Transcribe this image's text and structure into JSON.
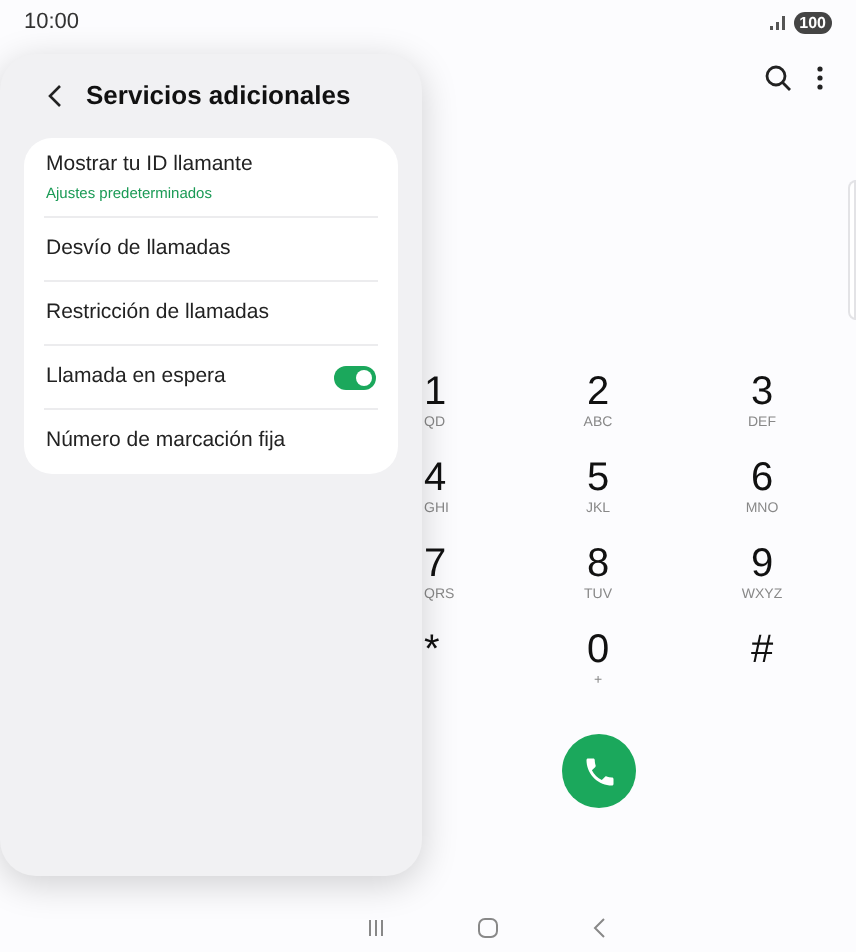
{
  "status_bar": {
    "time": "10:00",
    "battery": "100"
  },
  "panel": {
    "title": "Servicios adicionales",
    "items": [
      {
        "kind": "link",
        "label": "Mostrar tu ID llamante",
        "subtitle": "Ajustes predeterminados"
      },
      {
        "kind": "link",
        "label": "Desvío de llamadas"
      },
      {
        "kind": "link",
        "label": "Restricción de llamadas"
      },
      {
        "kind": "toggle",
        "label": "Llamada en espera",
        "on": true
      },
      {
        "kind": "link",
        "label": "Número de marcación fija"
      }
    ]
  },
  "keypad": [
    {
      "digit": "1",
      "letters": "QD"
    },
    {
      "digit": "2",
      "letters": "ABC"
    },
    {
      "digit": "3",
      "letters": "DEF"
    },
    {
      "digit": "4",
      "letters": "GHI"
    },
    {
      "digit": "5",
      "letters": "JKL"
    },
    {
      "digit": "6",
      "letters": "MNO"
    },
    {
      "digit": "7",
      "letters": "QRS"
    },
    {
      "digit": "8",
      "letters": "TUV"
    },
    {
      "digit": "9",
      "letters": "WXYZ"
    },
    {
      "digit": "*"
    },
    {
      "digit": "0",
      "letters": "+"
    },
    {
      "digit": "#"
    }
  ]
}
